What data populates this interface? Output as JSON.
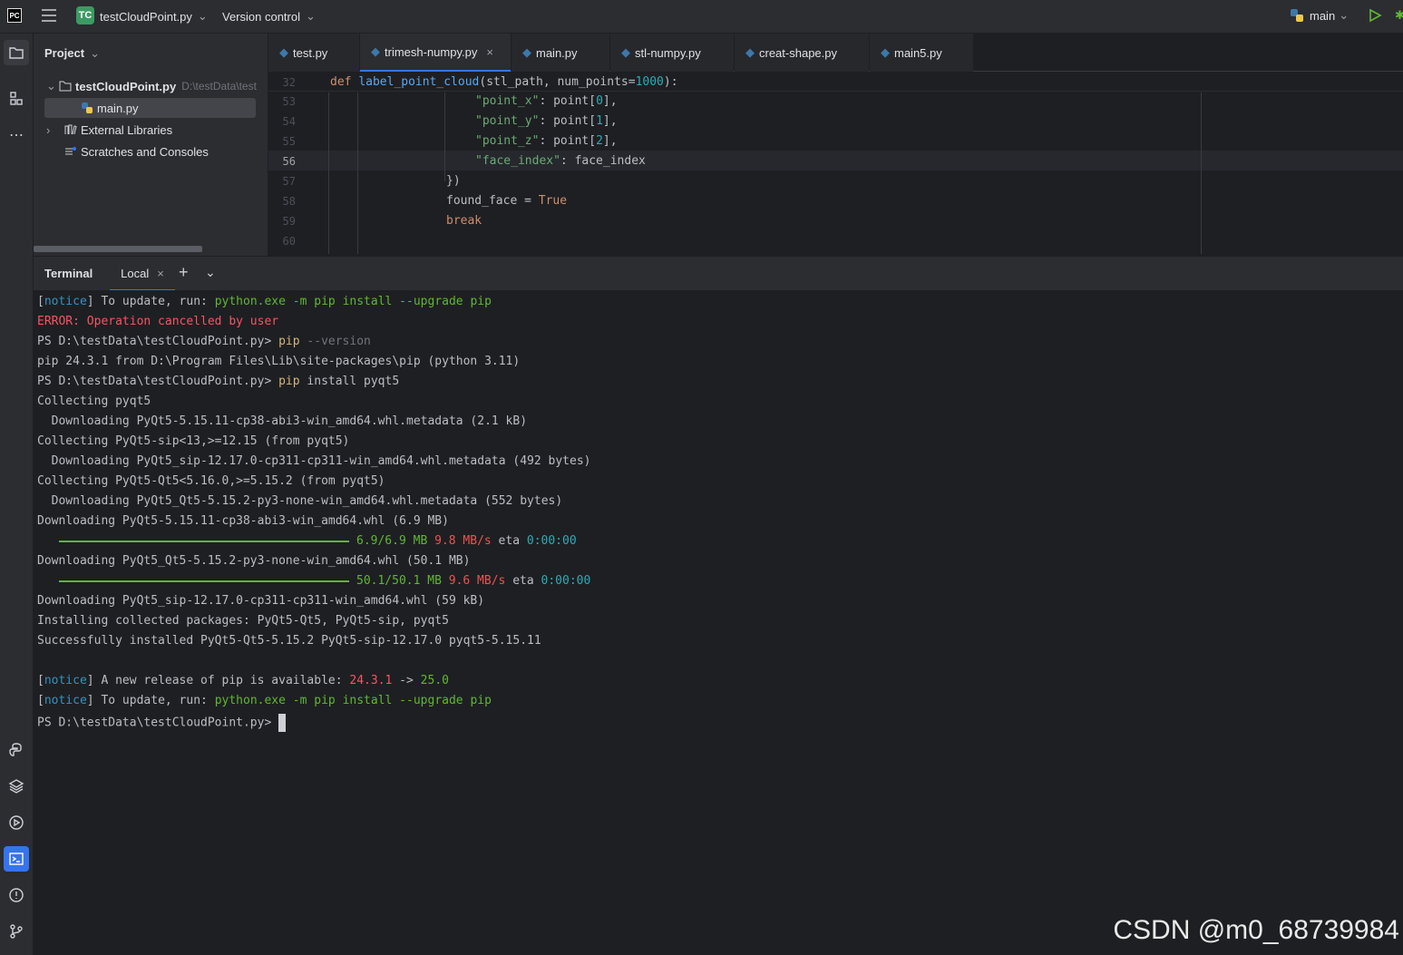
{
  "topbar": {
    "app_logo": "PC",
    "project_badge": "TC",
    "project_name": "testCloudPoint.py",
    "vcs_label": "Version control",
    "run_config": "main"
  },
  "project_panel": {
    "title": "Project",
    "root_name": "testCloudPoint.py",
    "root_path": "D:\\testData\\test",
    "file": "main.py",
    "external_libs": "External Libraries",
    "scratches": "Scratches and Consoles"
  },
  "tabs": [
    {
      "label": "test.py"
    },
    {
      "label": "trimesh-numpy.py"
    },
    {
      "label": "main.py"
    },
    {
      "label": "stl-numpy.py"
    },
    {
      "label": "creat-shape.py"
    },
    {
      "label": "main5.py"
    }
  ],
  "editor": {
    "line_numbers": [
      "32",
      "53",
      "54",
      "55",
      "56",
      "57",
      "58",
      "59",
      "60"
    ],
    "sticky": {
      "kw": "def ",
      "fn": "label_point_cloud",
      "args": "(stl_path, num_points=",
      "num": "1000",
      "end": "):"
    },
    "lines": [
      {
        "s": "\"point_x\"",
        "m": ": point[",
        "n": "0",
        "e": "],"
      },
      {
        "s": "\"point_y\"",
        "m": ": point[",
        "n": "1",
        "e": "],"
      },
      {
        "s": "\"point_z\"",
        "m": ": point[",
        "n": "2",
        "e": "],"
      },
      {
        "s": "\"face_index\"",
        "m": ": face_index",
        "n": "",
        "e": ""
      }
    ],
    "close_brace": "})",
    "found_face": "found_face = ",
    "true_kw": "True",
    "break_kw": "break"
  },
  "terminal": {
    "title": "Terminal",
    "tab_local": "Local",
    "lines": {
      "l1a": "[",
      "l1b": "notice",
      "l1c": "] To update, run: ",
      "l1d": "python.exe -m pip install --upgrade pip",
      "l2": "ERROR: Operation cancelled by user",
      "l3a": "PS D:\\testData\\testCloudPoint.py> ",
      "l3b": "pip",
      "l3c": " --version",
      "l4": "pip 24.3.1 from D:\\Program Files\\Lib\\site-packages\\pip (python 3.11)",
      "l5a": "PS D:\\testData\\testCloudPoint.py> ",
      "l5b": "pip",
      "l5c": " install pyqt5",
      "l6": "Collecting pyqt5",
      "l7": "  Downloading PyQt5-5.15.11-cp38-abi3-win_amd64.whl.metadata (2.1 kB)",
      "l8": "Collecting PyQt5-sip<13,>=12.15 (from pyqt5)",
      "l9": "  Downloading PyQt5_sip-12.17.0-cp311-cp311-win_amd64.whl.metadata (492 bytes)",
      "l10": "Collecting PyQt5-Qt5<5.16.0,>=5.15.2 (from pyqt5)",
      "l11": "  Downloading PyQt5_Qt5-5.15.2-py3-none-win_amd64.whl.metadata (552 bytes)",
      "l12": "Downloading PyQt5-5.15.11-cp38-abi3-win_amd64.whl (6.9 MB)",
      "p1a": "6.9/6.9 MB",
      "p1b": "9.8 MB/s",
      "p1c": " eta ",
      "p1d": "0:00:00",
      "l14": "Downloading PyQt5_Qt5-5.15.2-py3-none-win_amd64.whl (50.1 MB)",
      "p2a": "50.1/50.1 MB",
      "p2b": "9.6 MB/s",
      "p2c": " eta ",
      "p2d": "0:00:00",
      "l16": "Downloading PyQt5_sip-12.17.0-cp311-cp311-win_amd64.whl (59 kB)",
      "l17": "Installing collected packages: PyQt5-Qt5, PyQt5-sip, pyqt5",
      "l18": "Successfully installed PyQt5-Qt5-5.15.2 PyQt5-sip-12.17.0 pyqt5-5.15.11",
      "l20a": "[",
      "l20b": "notice",
      "l20c": "] A new release of pip is available: ",
      "l20d": "24.3.1",
      "l20e": " -> ",
      "l20f": "25.0",
      "l21a": "[",
      "l21b": "notice",
      "l21c": "] To update, run: ",
      "l21d": "python.exe -m pip install --upgrade pip",
      "l22": "PS D:\\testData\\testCloudPoint.py> "
    }
  },
  "watermark": "CSDN @m0_68739984",
  "progress": [
    1.0,
    1.0
  ]
}
